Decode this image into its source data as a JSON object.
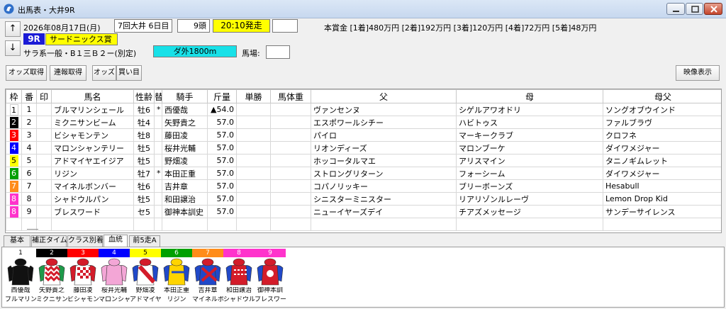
{
  "window": {
    "title": "出馬表・大井9R"
  },
  "header": {
    "date": "2026年08月17日(月)",
    "meeting": "7回大井 6日目",
    "heads": "9頭",
    "start_time": "20:10発走",
    "race_number": "9R",
    "race_name": "サードニックス賞",
    "condition": "サラ系一般・B１三Ｂ２ー(別定)",
    "surface": "ダ外1800m",
    "track_label": "馬場:",
    "prize": "本賞金 [1着]480万円 [2着]192万円 [3着]120万円 [4着]72万円 [5着]48万円",
    "up_arrow": "↑",
    "down_arrow": "↓"
  },
  "toolbar": {
    "odds_label": "オッズ取得",
    "results_label": "連報取得",
    "odds2_label": "オッズ",
    "bet_label": "買い目",
    "video_label": "映像表示"
  },
  "table": {
    "columns": [
      "枠",
      "番",
      "印",
      "馬名",
      "性齢",
      "替",
      "騎手",
      "斤量",
      "単勝",
      "馬体重",
      "父",
      "母",
      "母父"
    ],
    "rows": [
      {
        "waku": "1",
        "num": "1",
        "mark": "",
        "name": "ブルマリンシェール",
        "sex_age": "牡6",
        "change": "*",
        "jockey": "西優哉",
        "weight_prefix": "▲",
        "weight": "54.0",
        "sire": "ヴァンセンヌ",
        "dam": "シゲルアワオドリ",
        "damsire": "ソングオブウインド"
      },
      {
        "waku": "2",
        "num": "2",
        "mark": "",
        "name": "ミクニサンビーム",
        "sex_age": "牡4",
        "change": "",
        "jockey": "矢野貴之",
        "weight_prefix": "",
        "weight": "57.0",
        "sire": "エスポワールシチー",
        "dam": "ハビトゥス",
        "damsire": "ファルブラヴ"
      },
      {
        "waku": "3",
        "num": "3",
        "mark": "",
        "name": "ビシャモンテン",
        "sex_age": "牡8",
        "change": "",
        "jockey": "藤田凌",
        "weight_prefix": "",
        "weight": "57.0",
        "sire": "パイロ",
        "dam": "マーキークラブ",
        "damsire": "クロフネ"
      },
      {
        "waku": "4",
        "num": "4",
        "mark": "",
        "name": "マロンシャンテリー",
        "sex_age": "牡5",
        "change": "",
        "jockey": "桜井光輔",
        "weight_prefix": "",
        "weight": "57.0",
        "sire": "リオンディーズ",
        "dam": "マロンブーケ",
        "damsire": "ダイワメジャー"
      },
      {
        "waku": "5",
        "num": "5",
        "mark": "",
        "name": "アドマイヤエイジア",
        "sex_age": "牡5",
        "change": "",
        "jockey": "野畑凌",
        "weight_prefix": "",
        "weight": "57.0",
        "sire": "ホッコータルマエ",
        "dam": "アリスマイン",
        "damsire": "タニノギムレット"
      },
      {
        "waku": "6",
        "num": "6",
        "mark": "",
        "name": "リジン",
        "sex_age": "牡7",
        "change": "*",
        "jockey": "本田正重",
        "weight_prefix": "",
        "weight": "57.0",
        "sire": "ストロングリターン",
        "dam": "フォーシーム",
        "damsire": "ダイワメジャー"
      },
      {
        "waku": "7",
        "num": "7",
        "mark": "",
        "name": "マイネルボンバー",
        "sex_age": "牡6",
        "change": "",
        "jockey": "吉井章",
        "weight_prefix": "",
        "weight": "57.0",
        "sire": "コパノリッキー",
        "dam": "ブリーボーンズ",
        "damsire": "Hesabull"
      },
      {
        "waku": "8",
        "num": "8",
        "mark": "",
        "name": "シャドウルパン",
        "sex_age": "牡5",
        "change": "",
        "jockey": "和田譲治",
        "weight_prefix": "",
        "weight": "57.0",
        "sire": "シニスターミニスター",
        "dam": "リアリゾンルレーヴ",
        "damsire": "Lemon Drop Kid"
      },
      {
        "waku": "8",
        "num": "9",
        "mark": "",
        "name": "ブレスワード",
        "sex_age": "セ5",
        "change": "",
        "jockey": "御神本訓史",
        "weight_prefix": "",
        "weight": "57.0",
        "sire": "ニューイヤーズデイ",
        "dam": "チアズメッセージ",
        "damsire": "サンデーサイレンス"
      }
    ]
  },
  "tabs": [
    "基本",
    "補正タイム",
    "クラス別着",
    "血統",
    "前5走A"
  ],
  "silks": [
    {
      "num": "1",
      "jockey": "西優哉",
      "horse": "ブルマリンシェール"
    },
    {
      "num": "2",
      "jockey": "矢野貴之",
      "horse": "ミクニサンビーム"
    },
    {
      "num": "3",
      "jockey": "藤田凌",
      "horse": "ビシャモンテン"
    },
    {
      "num": "4",
      "jockey": "桜井光輔",
      "horse": "マロンシャンテリー"
    },
    {
      "num": "5",
      "jockey": "野畑凌",
      "horse": "アドマイヤエイジア"
    },
    {
      "num": "6",
      "jockey": "本田正重",
      "horse": "リジン"
    },
    {
      "num": "7",
      "jockey": "吉井章",
      "horse": "マイネルボンバー"
    },
    {
      "num": "8",
      "jockey": "和田譲治",
      "horse": "シャドウルパン"
    },
    {
      "num": "9",
      "jockey": "御神本訓",
      "horse": "ブレスワード"
    }
  ],
  "colors": {
    "waku": {
      "1": "#ffffff",
      "2": "#000000",
      "3": "#ff0000",
      "4": "#0000ff",
      "5": "#ffff00",
      "6": "#00a000",
      "7": "#ff8c1a",
      "8": "#ff33cc"
    },
    "waku_text": {
      "1": "#000000",
      "2": "#ffffff",
      "3": "#ffffff",
      "4": "#ffffff",
      "5": "#000000",
      "6": "#ffffff",
      "7": "#ffffff",
      "8": "#ffffff"
    },
    "race_number_bg": "#1b1bd6",
    "race_name_bg": "#ffff00",
    "surface_bg": "#18e1e8"
  },
  "icons": {
    "app": "horse-app-icon",
    "minimize": "minimize-icon",
    "maximize": "maximize-icon",
    "close": "close-icon"
  }
}
